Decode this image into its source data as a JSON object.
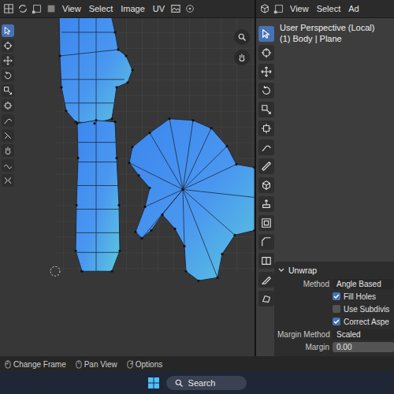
{
  "uv_editor": {
    "menu": [
      "View",
      "Select",
      "Image",
      "UV"
    ],
    "tools": [
      {
        "selected": true
      },
      {
        "selected": false
      },
      {
        "selected": false
      },
      {
        "selected": false
      },
      {
        "selected": false
      },
      {
        "selected": false
      },
      {
        "selected": false
      },
      {
        "selected": false
      },
      {
        "selected": false
      },
      {
        "selected": false
      },
      {
        "selected": false
      }
    ]
  },
  "viewport": {
    "menu": [
      "View",
      "Select",
      "Ad"
    ],
    "info": [
      "User Perspective (Local)",
      "(1) Body | Plane"
    ],
    "tools": [
      {
        "selected": true
      },
      {
        "selected": false
      },
      {
        "selected": false
      },
      {
        "selected": false
      },
      {
        "selected": false
      },
      {
        "selected": false
      },
      {
        "selected": false
      },
      {
        "selected": false
      },
      {
        "selected": false
      },
      {
        "selected": false
      },
      {
        "selected": false
      },
      {
        "selected": false
      },
      {
        "selected": false
      },
      {
        "selected": false
      },
      {
        "selected": false
      }
    ]
  },
  "unwrap_panel": {
    "title": "Unwrap",
    "expanded": true,
    "rows": [
      {
        "kind": "dropdown",
        "label": "Method",
        "value": "Angle Based"
      },
      {
        "kind": "checkbox",
        "label": "Fill Holes",
        "checked": true
      },
      {
        "kind": "checkbox",
        "label": "Use Subdivis",
        "checked": false
      },
      {
        "kind": "checkbox",
        "label": "Correct Aspe",
        "checked": true
      },
      {
        "kind": "dropdown",
        "label": "Margin Method",
        "value": "Scaled"
      },
      {
        "kind": "number",
        "label": "Margin",
        "value": "0.00"
      }
    ]
  },
  "status_bar": [
    "Change Frame",
    "Pan View",
    "Options"
  ],
  "taskbar": {
    "search": {
      "placeholder": "Search"
    }
  }
}
